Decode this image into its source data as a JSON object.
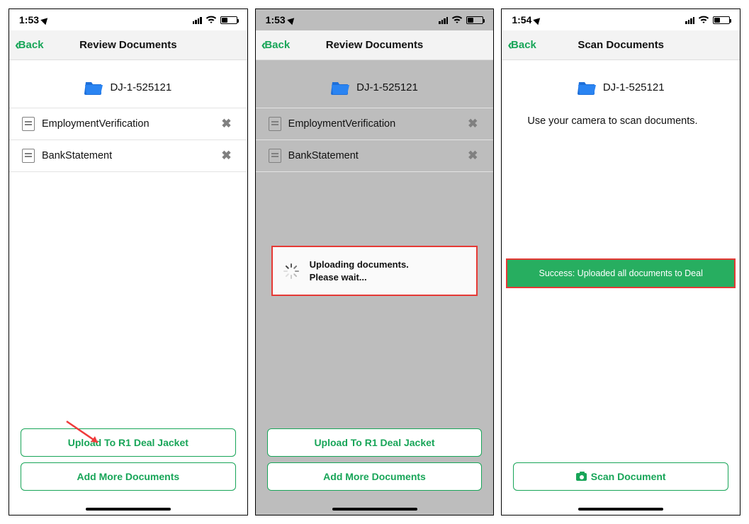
{
  "screens": [
    {
      "time": "1:53",
      "nav_title": "Review Documents",
      "back_label": "Back",
      "folder_label": "DJ-1-525121",
      "documents": [
        {
          "name": "EmploymentVerification"
        },
        {
          "name": "BankStatement"
        }
      ],
      "primary_button": "Upload To R1 Deal Jacket",
      "secondary_button": "Add More Documents"
    },
    {
      "time": "1:53",
      "nav_title": "Review Documents",
      "back_label": "Back",
      "folder_label": "DJ-1-525121",
      "documents": [
        {
          "name": "EmploymentVerification"
        },
        {
          "name": "BankStatement"
        }
      ],
      "primary_button": "Upload To R1 Deal Jacket",
      "secondary_button": "Add More Documents",
      "uploading_line1": "Uploading documents.",
      "uploading_line2": "Please wait..."
    },
    {
      "time": "1:54",
      "nav_title": "Scan Documents",
      "back_label": "Back",
      "folder_label": "DJ-1-525121",
      "instruction": "Use your camera to scan documents.",
      "success_message": "Success: Uploaded all documents to Deal",
      "scan_button": "Scan Document"
    }
  ]
}
